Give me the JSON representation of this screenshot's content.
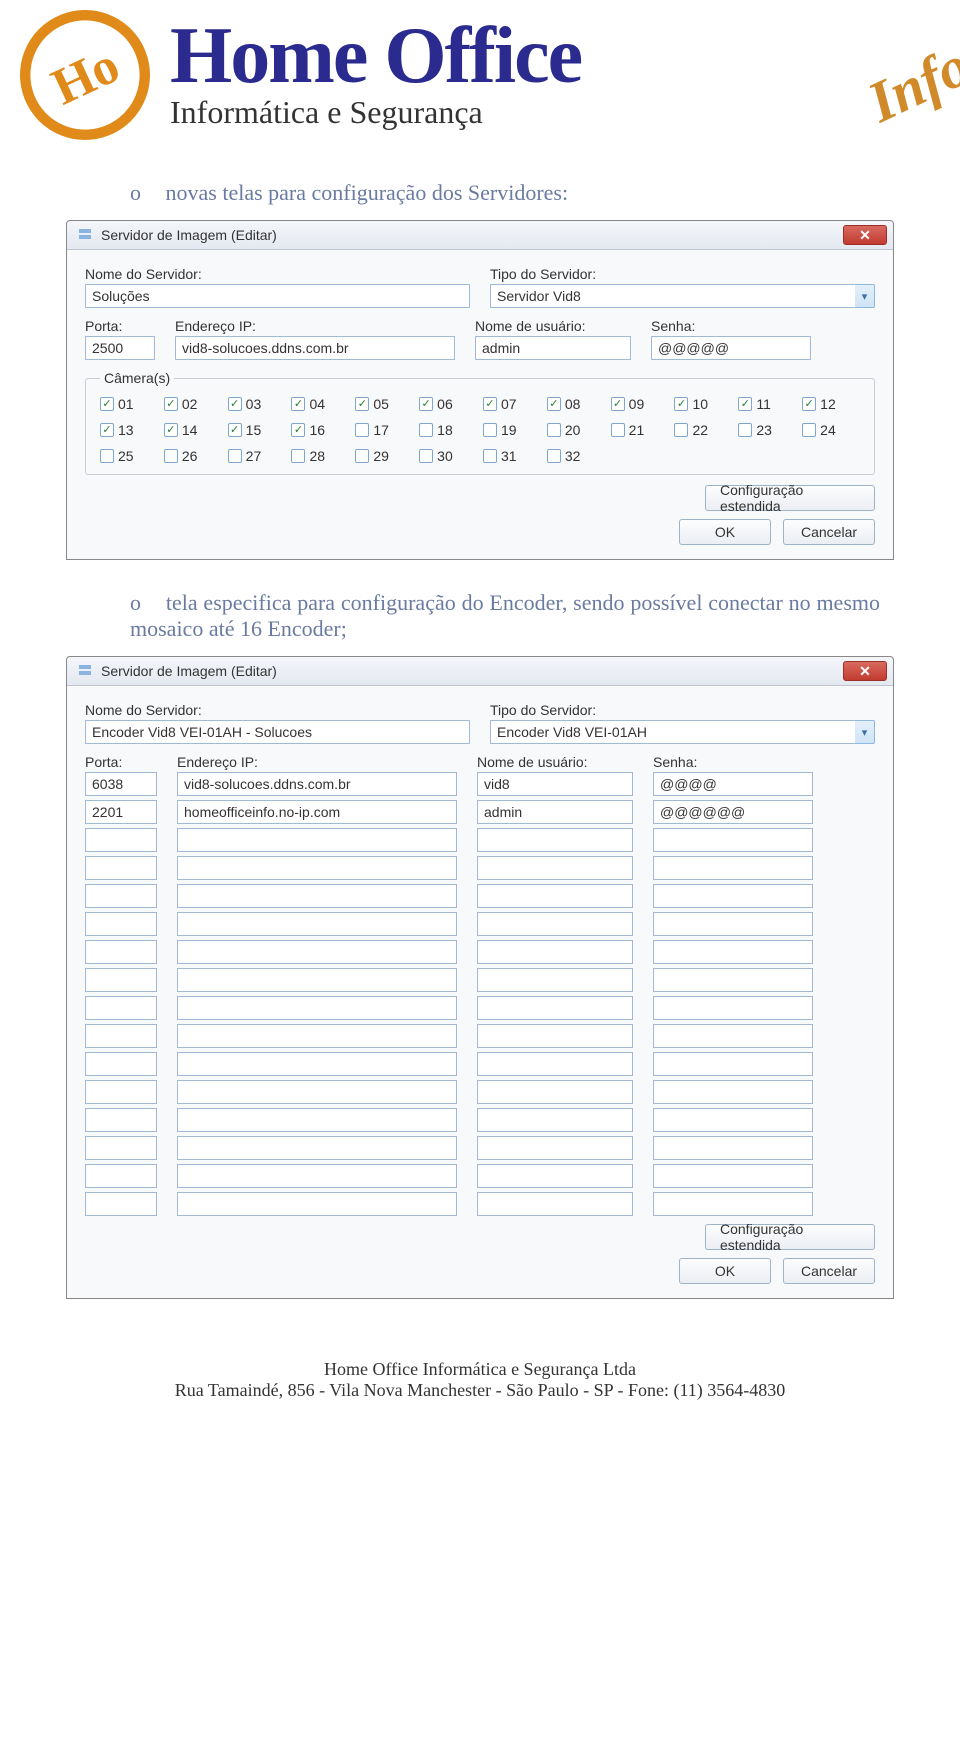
{
  "header": {
    "title": "Home Office",
    "subtitle": "Informática e Segurança",
    "script": "Info"
  },
  "paragraphs": {
    "p1": "novas telas para configuração dos Servidores:",
    "p2": "tela especifica para configuração do Encoder, sendo possível conectar no mesmo mosaico até 16 Encoder;"
  },
  "dialog1": {
    "title": "Servidor de Imagem  (Editar)",
    "labels": {
      "nome": "Nome do Servidor:",
      "tipo": "Tipo do Servidor:",
      "porta": "Porta:",
      "ip": "Endereço IP:",
      "user": "Nome de usuário:",
      "senha": "Senha:",
      "cameras_legend": "Câmera(s)"
    },
    "values": {
      "nome": "Soluções",
      "tipo": "Servidor Vid8",
      "porta": "2500",
      "ip": "vid8-solucoes.ddns.com.br",
      "user": "admin",
      "senha": "@@@@@"
    },
    "cameras": [
      {
        "n": "01",
        "c": true
      },
      {
        "n": "02",
        "c": true
      },
      {
        "n": "03",
        "c": true
      },
      {
        "n": "04",
        "c": true
      },
      {
        "n": "05",
        "c": true
      },
      {
        "n": "06",
        "c": true
      },
      {
        "n": "07",
        "c": true
      },
      {
        "n": "08",
        "c": true
      },
      {
        "n": "09",
        "c": true
      },
      {
        "n": "10",
        "c": true
      },
      {
        "n": "11",
        "c": true
      },
      {
        "n": "12",
        "c": true
      },
      {
        "n": "13",
        "c": true
      },
      {
        "n": "14",
        "c": true
      },
      {
        "n": "15",
        "c": true
      },
      {
        "n": "16",
        "c": true
      },
      {
        "n": "17",
        "c": false
      },
      {
        "n": "18",
        "c": false
      },
      {
        "n": "19",
        "c": false
      },
      {
        "n": "20",
        "c": false
      },
      {
        "n": "21",
        "c": false
      },
      {
        "n": "22",
        "c": false
      },
      {
        "n": "23",
        "c": false
      },
      {
        "n": "24",
        "c": false
      },
      {
        "n": "25",
        "c": false
      },
      {
        "n": "26",
        "c": false
      },
      {
        "n": "27",
        "c": false
      },
      {
        "n": "28",
        "c": false
      },
      {
        "n": "29",
        "c": false
      },
      {
        "n": "30",
        "c": false
      },
      {
        "n": "31",
        "c": false
      },
      {
        "n": "32",
        "c": false
      }
    ],
    "buttons": {
      "ext": "Configuração estendida",
      "ok": "OK",
      "cancel": "Cancelar"
    }
  },
  "dialog2": {
    "title": "Servidor de Imagem  (Editar)",
    "labels": {
      "nome": "Nome do Servidor:",
      "tipo": "Tipo do Servidor:",
      "porta": "Porta:",
      "ip": "Endereço IP:",
      "user": "Nome de usuário:",
      "senha": "Senha:"
    },
    "values": {
      "nome": "Encoder Vid8 VEI-01AH - Solucoes",
      "tipo": "Encoder Vid8 VEI-01AH"
    },
    "rows": [
      {
        "porta": "6038",
        "ip": "vid8-solucoes.ddns.com.br",
        "user": "vid8",
        "senha": "@@@@"
      },
      {
        "porta": "2201",
        "ip": "homeofficeinfo.no-ip.com",
        "user": "admin",
        "senha": "@@@@@@"
      },
      {
        "porta": "",
        "ip": "",
        "user": "",
        "senha": ""
      },
      {
        "porta": "",
        "ip": "",
        "user": "",
        "senha": ""
      },
      {
        "porta": "",
        "ip": "",
        "user": "",
        "senha": ""
      },
      {
        "porta": "",
        "ip": "",
        "user": "",
        "senha": ""
      },
      {
        "porta": "",
        "ip": "",
        "user": "",
        "senha": ""
      },
      {
        "porta": "",
        "ip": "",
        "user": "",
        "senha": ""
      },
      {
        "porta": "",
        "ip": "",
        "user": "",
        "senha": ""
      },
      {
        "porta": "",
        "ip": "",
        "user": "",
        "senha": ""
      },
      {
        "porta": "",
        "ip": "",
        "user": "",
        "senha": ""
      },
      {
        "porta": "",
        "ip": "",
        "user": "",
        "senha": ""
      },
      {
        "porta": "",
        "ip": "",
        "user": "",
        "senha": ""
      },
      {
        "porta": "",
        "ip": "",
        "user": "",
        "senha": ""
      },
      {
        "porta": "",
        "ip": "",
        "user": "",
        "senha": ""
      },
      {
        "porta": "",
        "ip": "",
        "user": "",
        "senha": ""
      }
    ],
    "buttons": {
      "ext": "Configuração estendida",
      "ok": "OK",
      "cancel": "Cancelar"
    }
  },
  "footer": {
    "line1": "Home Office Informática e Segurança Ltda",
    "line2": "Rua Tamaindé, 856  -  Vila Nova Manchester  -  São Paulo  -  SP  -  Fone: (11) 3564-4830"
  }
}
